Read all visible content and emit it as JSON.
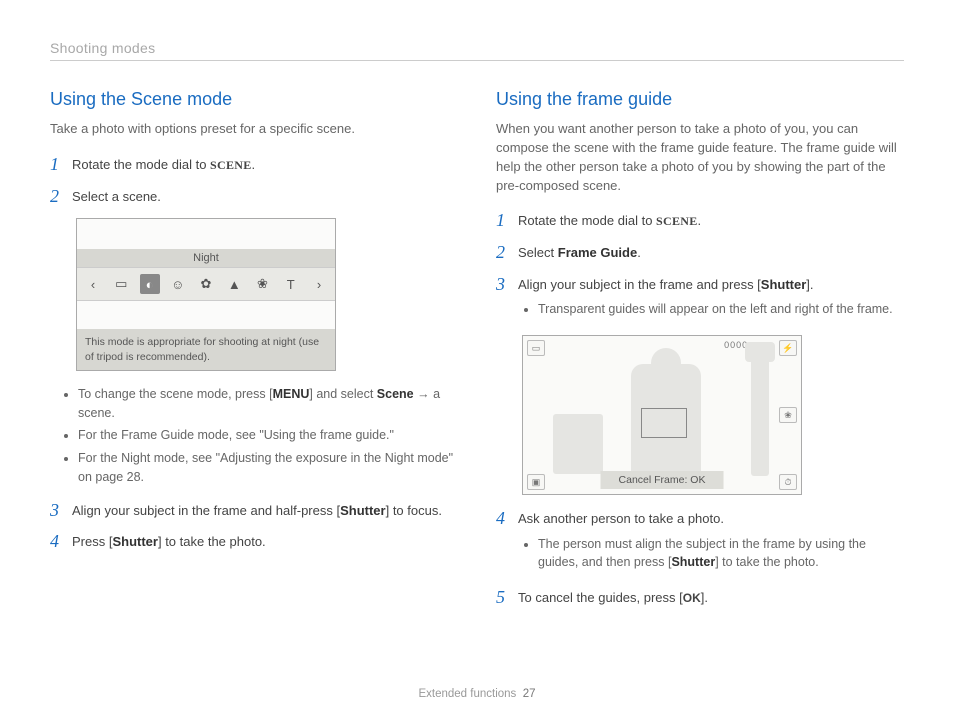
{
  "header": "Shooting modes",
  "footer": {
    "section": "Extended functions",
    "page": "27"
  },
  "left": {
    "title": "Using the Scene mode",
    "intro": "Take a photo with options preset for a specific scene.",
    "step1_a": "Rotate the mode dial to ",
    "scene_word": "SCENE",
    "period": ".",
    "step2": "Select a scene.",
    "screen": {
      "label": "Night",
      "desc": "This mode is appropriate for shooting at night (use of tripod is recommended)."
    },
    "bullets": {
      "b1_a": "To change the scene mode, press [",
      "b1_menu": "MENU",
      "b1_b": "] and select ",
      "b1_scene": "Scene",
      "b1_c": " → a scene.",
      "b2": "For the Frame Guide mode, see \"Using the frame guide.\"",
      "b3": "For the Night mode, see \"Adjusting the exposure in the Night mode\" on page 28."
    },
    "step3_a": "Align your subject in the frame and half-press [",
    "step3_shutter": "Shutter",
    "step3_b": "] to focus.",
    "step4_a": "Press [",
    "step4_shutter": "Shutter",
    "step4_b": "] to take the photo."
  },
  "right": {
    "title": "Using the frame guide",
    "intro": "When you want another person to take a photo of you, you can compose the scene with the frame guide feature. The frame guide will help the other person take a photo of you by showing the part of the pre-composed scene.",
    "step1_a": "Rotate the mode dial to ",
    "scene_word": "SCENE",
    "period": ".",
    "step2_a": "Select ",
    "step2_b": "Frame Guide",
    "step2_c": ".",
    "step3_a": "Align your subject in the frame and press [",
    "step3_shutter": "Shutter",
    "step3_b": "].",
    "sub3": "Transparent guides will appear on the left and right of the frame.",
    "screen": {
      "counter": "0000",
      "cancel": "Cancel Frame: OK"
    },
    "step4": "Ask another person to take a photo.",
    "sub4_a": "The person must align the subject in the frame by using the guides, and then press [",
    "sub4_shutter": "Shutter",
    "sub4_b": "] to take the photo.",
    "step5_a": "To cancel the guides, press [",
    "step5_ok": "OK",
    "step5_b": "]."
  },
  "nums": {
    "n1": "1",
    "n2": "2",
    "n3": "3",
    "n4": "4",
    "n5": "5"
  }
}
